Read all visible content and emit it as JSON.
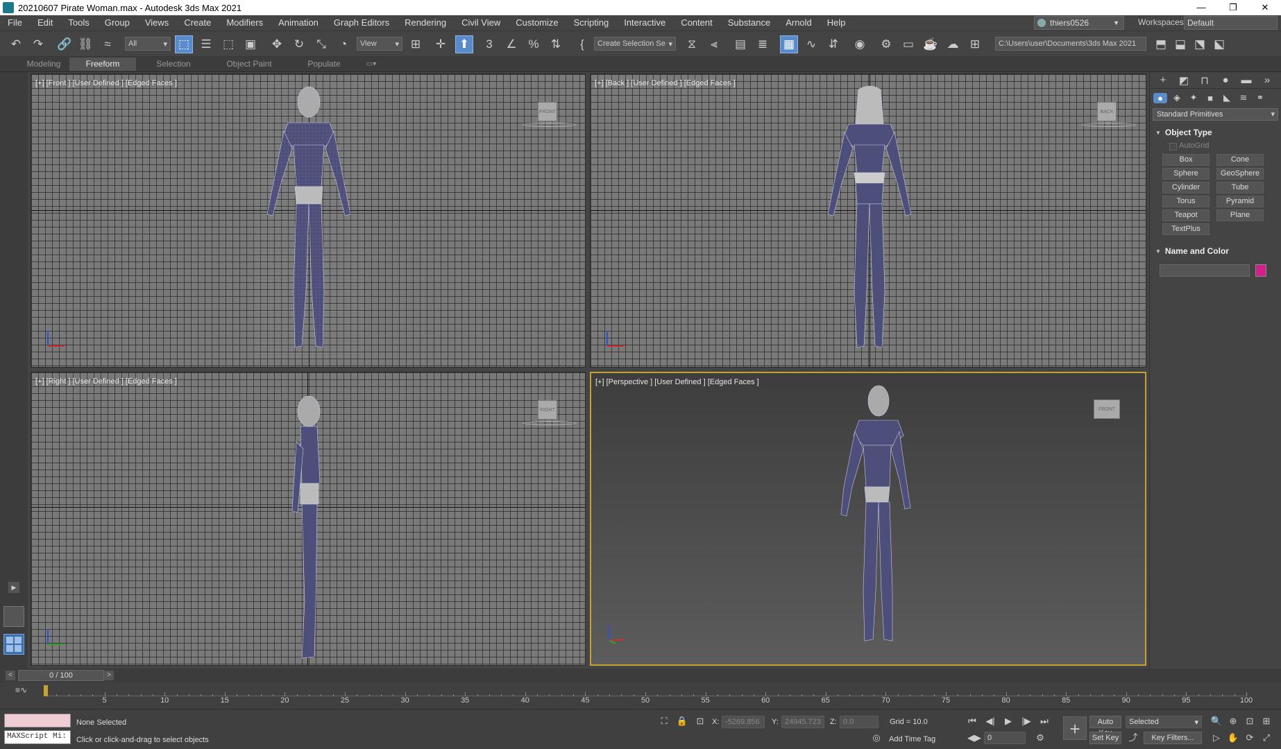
{
  "window": {
    "title": "20210607 Pirate Woman.max - Autodesk 3ds Max 2021",
    "minimize": "—",
    "maximize": "❐",
    "close": "✕"
  },
  "menu": [
    "File",
    "Edit",
    "Tools",
    "Group",
    "Views",
    "Create",
    "Modifiers",
    "Animation",
    "Graph Editors",
    "Rendering",
    "Civil View",
    "Customize",
    "Scripting",
    "Interactive",
    "Content",
    "Substance",
    "Arnold",
    "Help"
  ],
  "user": {
    "name": "thiers0526"
  },
  "workspace": {
    "label": "Workspaces:",
    "value": "Default"
  },
  "toolbar": {
    "filter": "All",
    "refcoord": "View",
    "selection_set": "Create Selection Se",
    "project_path": "C:\\Users\\user\\Documents\\3ds Max 2021"
  },
  "ribbon_tabs": [
    "Modeling",
    "Freeform",
    "Selection",
    "Object Paint",
    "Populate"
  ],
  "viewports": {
    "front": "[+] [Front ] [User Defined ] [Edged Faces ]",
    "back": "[+] [Back ] [User Defined ] [Edged Faces ]",
    "right": "[+] [Right ] [User Defined ] [Edged Faces ]",
    "perspective": "[+] [Perspective ] [User Defined ] [Edged Faces ]"
  },
  "command_panel": {
    "category": "Standard Primitives",
    "object_type_title": "Object Type",
    "autogrid": "AutoGrid",
    "buttons": [
      "Box",
      "Cone",
      "Sphere",
      "GeoSphere",
      "Cylinder",
      "Tube",
      "Torus",
      "Pyramid",
      "Teapot",
      "Plane",
      "TextPlus"
    ],
    "name_color_title": "Name and Color",
    "object_color": "#d0208a"
  },
  "timeline": {
    "frame_display": "0 / 100",
    "ticks": [
      "5",
      "10",
      "15",
      "20",
      "25",
      "30",
      "35",
      "40",
      "45",
      "50",
      "55",
      "60",
      "65",
      "70",
      "75",
      "80",
      "85",
      "90",
      "95",
      "100"
    ]
  },
  "status": {
    "selection": "None Selected",
    "prompt": "Click or click-and-drag to select objects",
    "maxscript": "MAXScript Mi:",
    "x_label": "X:",
    "x_value": "-5269.856",
    "y_label": "Y:",
    "y_value": "24945.723",
    "z_label": "Z:",
    "z_value": "0.0",
    "grid": "Grid = 10.0",
    "add_time_tag": "Add Time Tag",
    "auto_key": "Auto Key",
    "set_key": "Set Key",
    "key_mode": "Selected",
    "key_filters": "Key Filters...",
    "current_frame": "0"
  }
}
